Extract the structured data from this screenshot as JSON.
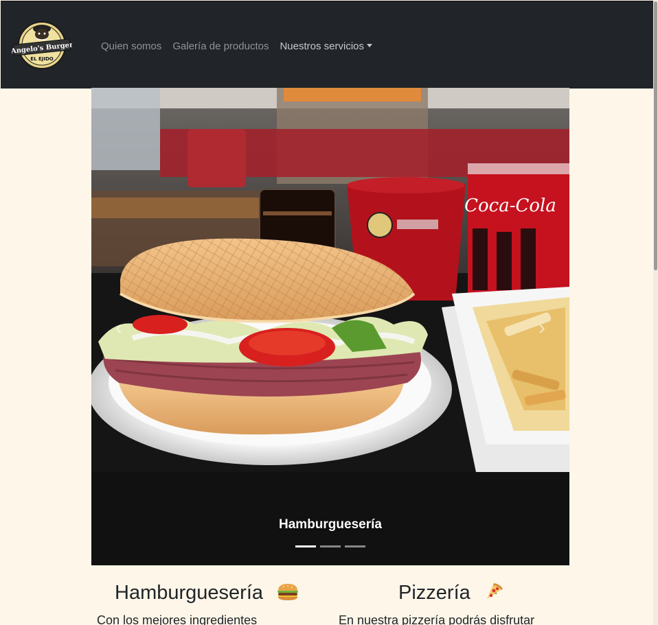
{
  "navbar": {
    "logo": {
      "line1": "Angelo's Burger",
      "line2": "EL EJIDO"
    },
    "links": [
      {
        "label": "Quien somos"
      },
      {
        "label": "Galería de productos"
      },
      {
        "label": "Nuestros servicios"
      }
    ]
  },
  "carousel": {
    "slide_caption": "Hamburguesería",
    "can_label": "Coca-Cola",
    "slides_count": 3,
    "active_slide": 1
  },
  "services": [
    {
      "title": "Hamburguesería",
      "icon": "hamburger-icon",
      "text": "Con los mejores ingredientes"
    },
    {
      "title": "Pizzería",
      "icon": "pizza-icon",
      "text": "En nuestra pizzería podrás disfrutar"
    }
  ],
  "colors": {
    "navbar_bg": "#212529",
    "page_bg": "#fdf6e9",
    "nav_link": "#8e9399"
  }
}
